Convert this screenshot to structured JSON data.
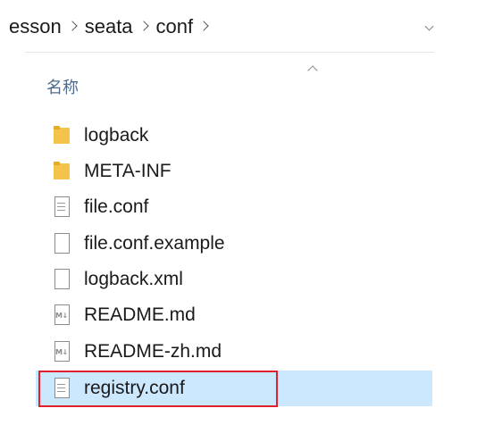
{
  "breadcrumb": {
    "items": [
      "esson",
      "seata",
      "conf"
    ]
  },
  "column": {
    "name_header": "名称"
  },
  "files": [
    {
      "name": "logback",
      "type": "folder"
    },
    {
      "name": "META-INF",
      "type": "folder"
    },
    {
      "name": "file.conf",
      "type": "text"
    },
    {
      "name": "file.conf.example",
      "type": "blank"
    },
    {
      "name": "logback.xml",
      "type": "blank"
    },
    {
      "name": "README.md",
      "type": "markdown",
      "badge": "M↓"
    },
    {
      "name": "README-zh.md",
      "type": "markdown",
      "badge": "M↓"
    },
    {
      "name": "registry.conf",
      "type": "text",
      "selected": true
    }
  ],
  "colors": {
    "selection": "#cce8ff",
    "highlight_border": "#e0202d",
    "folder": "#f3c34a"
  }
}
